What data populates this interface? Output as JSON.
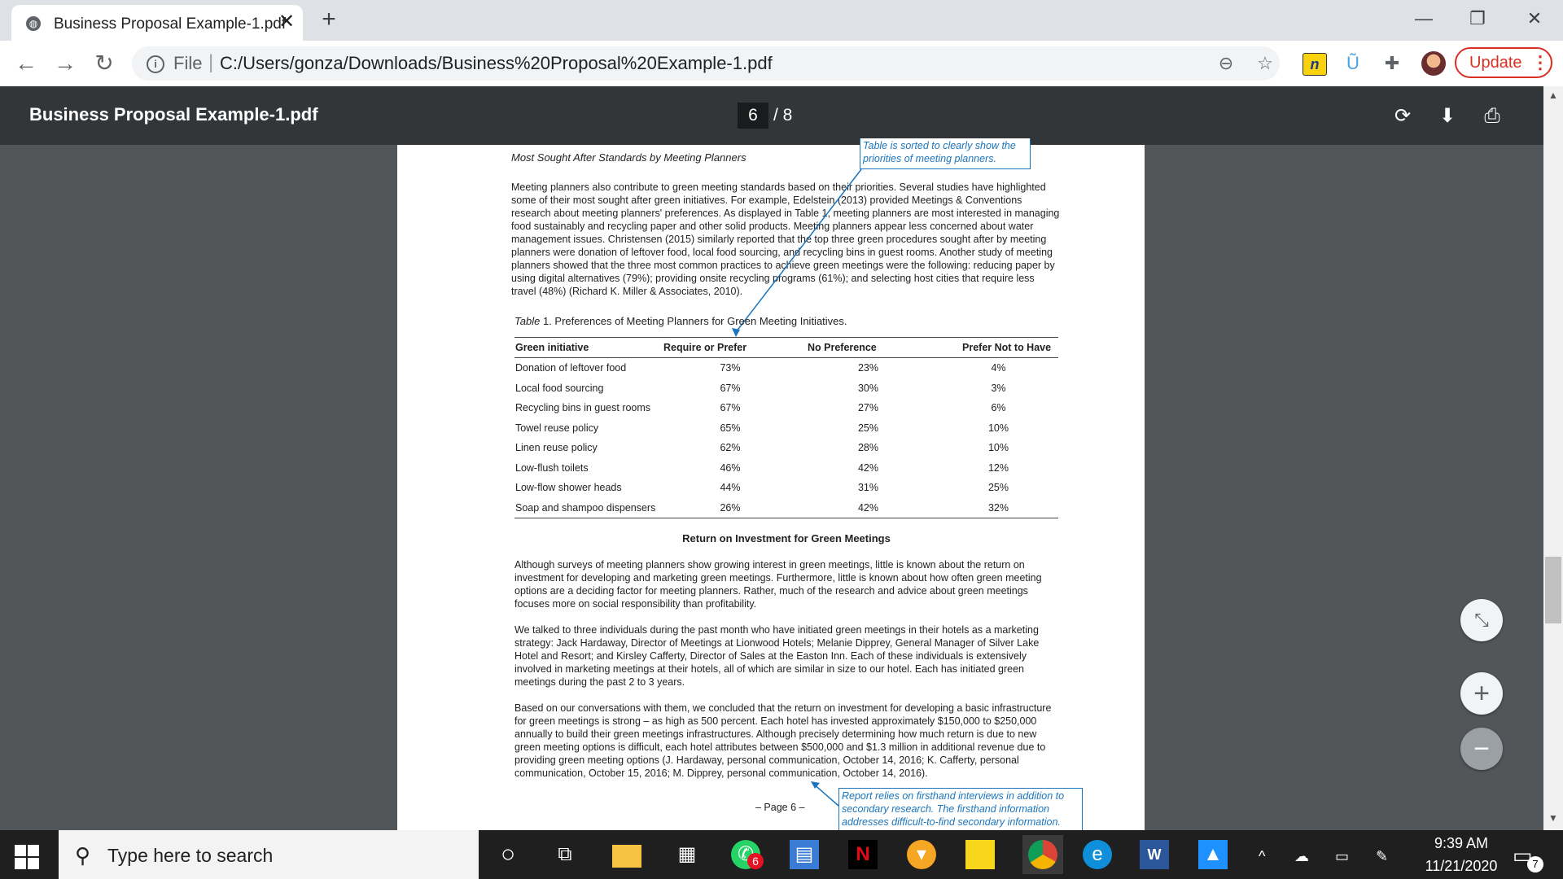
{
  "browser": {
    "tab_title": "Business Proposal Example-1.pdf",
    "tab_close": "✕",
    "new_tab": "+",
    "url_scheme": "File",
    "url_separator": "|",
    "url": "C:/Users/gonza/Downloads/Business%20Proposal%20Example-1.pdf",
    "update_label": "Update",
    "update_menu": "⋮"
  },
  "pdf_toolbar": {
    "title": "Business Proposal Example-1.pdf",
    "current_page": "6",
    "page_total": "/  8"
  },
  "document": {
    "callout_top": "Table is sorted to clearly show the priorities of meeting planners.",
    "section_heading": "Most Sought After Standards by Meeting Planners",
    "para1": "Meeting planners also contribute to green meeting standards based on their priorities. Several studies have highlighted some of their most sought after green initiatives. For example, Edelstein (2013) provided Meetings & Conventions research about meeting planners' preferences. As displayed in Table 1, meeting planners are most interested in managing food sustainably and recycling paper and other solid products. Meeting planners appear less concerned about water management issues. Christensen (2015) similarly reported that the top three green procedures sought after by meeting planners were donation of leftover food, local food sourcing, and recycling bins in guest rooms. Another study of meeting planners showed that the three most common practices to achieve green meetings were the following: reducing paper by using digital alternatives (79%); providing onsite recycling programs (61%); and selecting host cities that require less travel (48%) (Richard K. Miller & Associates, 2010).",
    "table_caption_italic": "Table",
    "table_caption_rest": " 1. Preferences of Meeting Planners for Green Meeting Initiatives.",
    "table": {
      "headers": [
        "Green initiative",
        "Require or Prefer",
        "No Preference",
        "Prefer Not to Have"
      ],
      "rows": [
        [
          "Donation of leftover food",
          "73%",
          "23%",
          "4%"
        ],
        [
          "Local food sourcing",
          "67%",
          "30%",
          "3%"
        ],
        [
          "Recycling bins in guest rooms",
          "67%",
          "27%",
          "6%"
        ],
        [
          "Towel reuse policy",
          "65%",
          "25%",
          "10%"
        ],
        [
          "Linen reuse policy",
          "62%",
          "28%",
          "10%"
        ],
        [
          "Low-flush toilets",
          "46%",
          "42%",
          "12%"
        ],
        [
          "Low-flow shower heads",
          "44%",
          "31%",
          "25%"
        ],
        [
          "Soap and shampoo dispensers",
          "26%",
          "42%",
          "32%"
        ]
      ]
    },
    "roi_heading": "Return on Investment for Green Meetings",
    "para2": "Although surveys of meeting planners show growing interest in green meetings, little is known about the return on investment for developing and marketing green meetings. Furthermore, little is known about how often green meeting options are a deciding factor for meeting planners. Rather, much of the research and advice about green meetings focuses more on social responsibility than profitability.",
    "para3": "We talked to three individuals during the past month who have initiated green meetings in their hotels as a marketing strategy: Jack Hardaway, Director of Meetings at Lionwood Hotels; Melanie Dipprey, General Manager of Silver Lake Hotel and Resort; and Kirsley Cafferty, Director of Sales at the Easton Inn. Each of these individuals is extensively involved in marketing meetings at their hotels, all of which are similar in size to our hotel. Each has initiated green meetings during the past 2 to 3 years.",
    "para4": "Based on our conversations with them, we concluded that the return on investment for developing a basic infrastructure for green meetings is strong – as high as 500 percent. Each hotel has invested approximately $150,000 to $250,000 annually to build their green meetings infrastructures. Although precisely determining how much return is due to new green meeting options is difficult, each hotel attributes between $500,000 and $1.3 million in additional revenue due to providing green meeting options (J. Hardaway, personal communication, October 14, 2016; K. Cafferty, personal communication, October 15, 2016; M. Dipprey, personal communication, October 14, 2016).",
    "page_footer": "– Page 6 –",
    "callout_bottom": "Report relies on firsthand interviews in addition to secondary research. The firsthand information addresses difficult-to-find secondary information."
  },
  "taskbar": {
    "search_placeholder": "Type here to search",
    "whatsapp_badge": "6",
    "time": "9:39 AM",
    "date": "11/21/2020",
    "notification_count": "7"
  },
  "colors": {
    "callout_blue": "#1c75bc",
    "update_red": "#d93025",
    "pdf_toolbar": "#323639",
    "viewer_bg": "#525659"
  }
}
